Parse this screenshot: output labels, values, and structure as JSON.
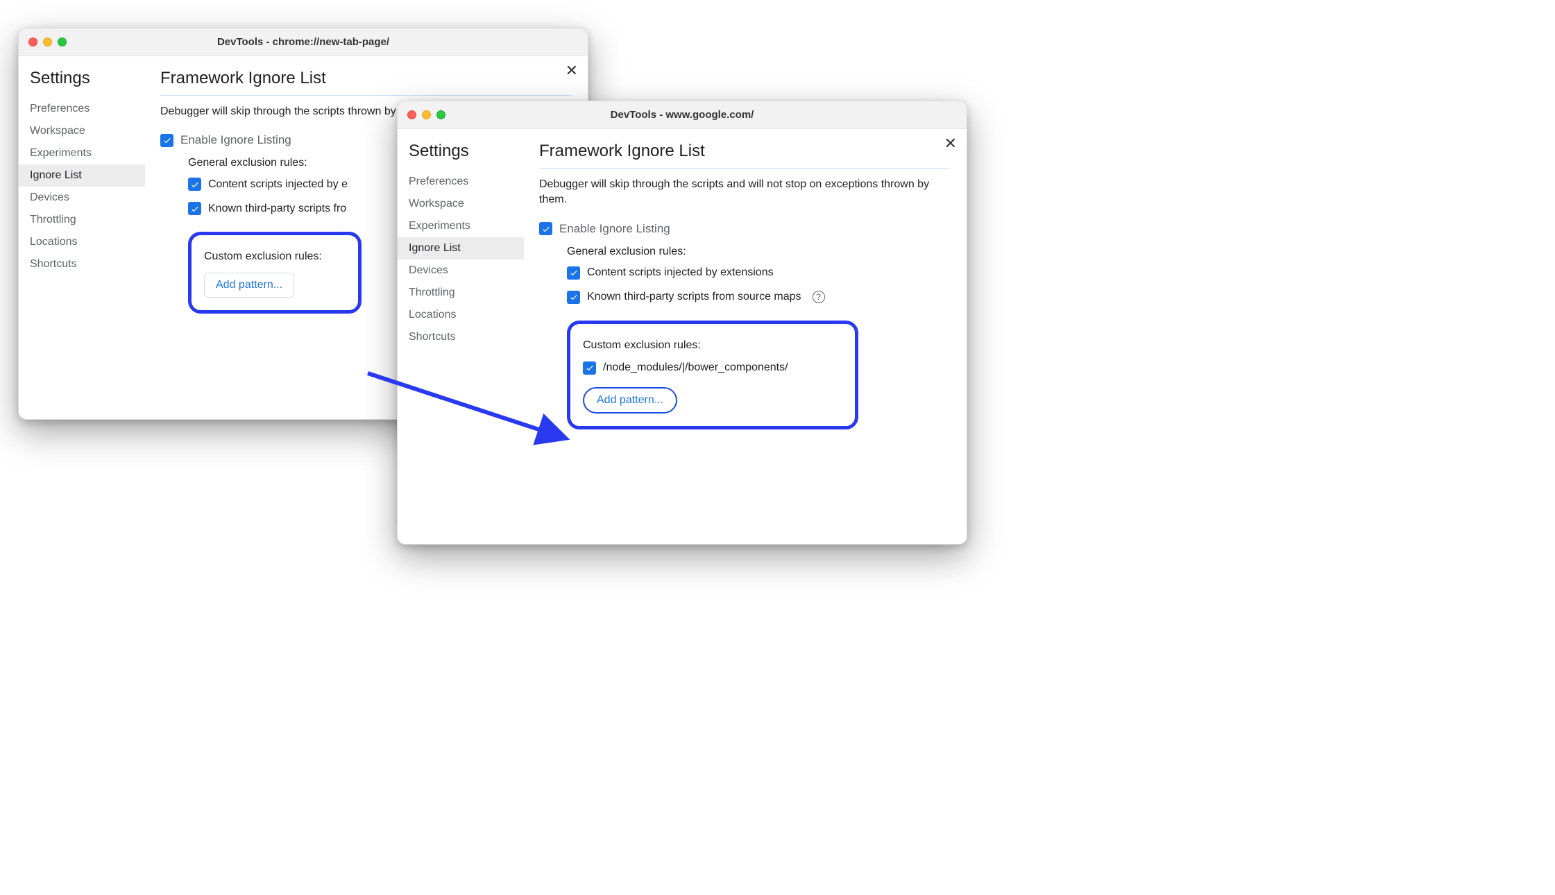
{
  "windowA": {
    "title": "DevTools - chrome://new-tab-page/",
    "settings_heading": "Settings",
    "sidebar": {
      "items": [
        {
          "label": "Preferences"
        },
        {
          "label": "Workspace"
        },
        {
          "label": "Experiments"
        },
        {
          "label": "Ignore List",
          "selected": true
        },
        {
          "label": "Devices"
        },
        {
          "label": "Throttling"
        },
        {
          "label": "Locations"
        },
        {
          "label": "Shortcuts"
        }
      ]
    },
    "page_title": "Framework Ignore List",
    "description": "Debugger will skip through the scripts and will not stop on exceptions thrown by them.",
    "description_truncated": "Debugger will skip through the scripts thrown by them.",
    "enable_label": "Enable Ignore Listing",
    "general_rules_label": "General exclusion rules:",
    "rule_content_scripts": "Content scripts injected by extensions",
    "rule_content_scripts_truncated": "Content scripts injected by e",
    "rule_third_party": "Known third-party scripts from source maps",
    "rule_third_party_truncated": "Known third-party scripts fro",
    "custom_rules_label": "Custom exclusion rules:",
    "add_pattern_label": "Add pattern..."
  },
  "windowB": {
    "title": "DevTools - www.google.com/",
    "settings_heading": "Settings",
    "sidebar": {
      "items": [
        {
          "label": "Preferences"
        },
        {
          "label": "Workspace"
        },
        {
          "label": "Experiments"
        },
        {
          "label": "Ignore List",
          "selected": true
        },
        {
          "label": "Devices"
        },
        {
          "label": "Throttling"
        },
        {
          "label": "Locations"
        },
        {
          "label": "Shortcuts"
        }
      ]
    },
    "page_title": "Framework Ignore List",
    "description": "Debugger will skip through the scripts and will not stop on exceptions thrown by them.",
    "enable_label": "Enable Ignore Listing",
    "general_rules_label": "General exclusion rules:",
    "rule_content_scripts": "Content scripts injected by extensions",
    "rule_third_party": "Known third-party scripts from source maps",
    "custom_rules_label": "Custom exclusion rules:",
    "pattern_value": "/node_modules/|/bower_components/",
    "add_pattern_label": "Add pattern..."
  }
}
